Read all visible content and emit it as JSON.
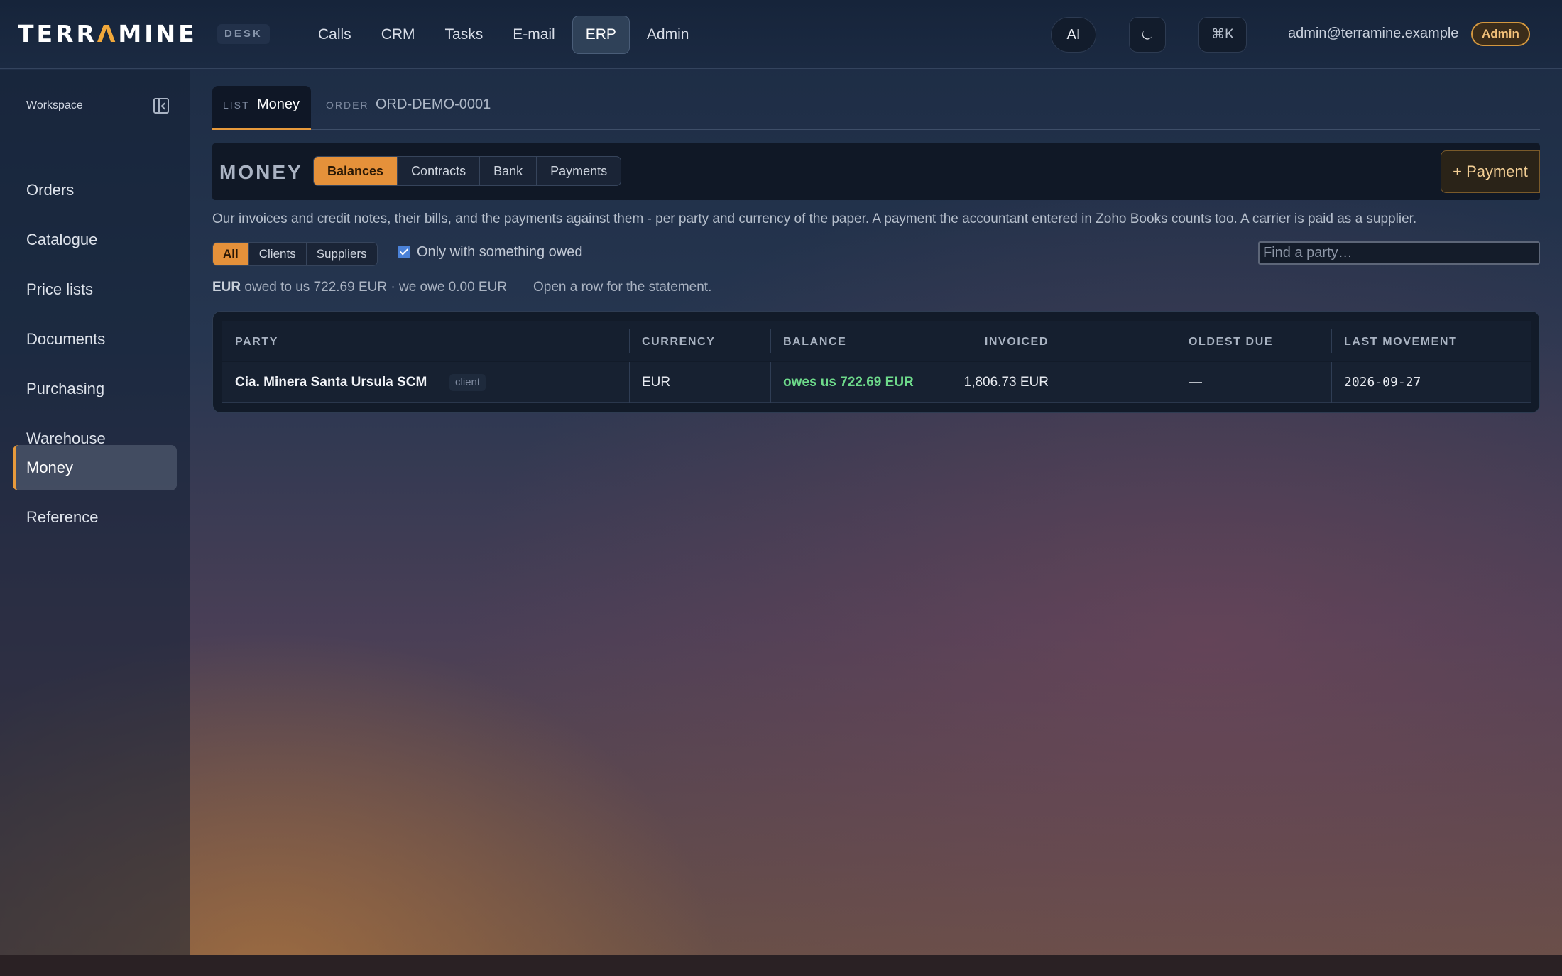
{
  "brand": {
    "logo_pre": "TERR",
    "logo_accent": "Λ",
    "logo_post": "MINE",
    "badge": "DESK",
    "accent_color": "#e5913a"
  },
  "nav": {
    "items": [
      "Calls",
      "CRM",
      "Tasks",
      "E-mail",
      "ERP",
      "Admin"
    ],
    "active": "ERP"
  },
  "header": {
    "ai_label": "AI",
    "theme_icon": "moon-icon",
    "shortcut_label": "⌘K",
    "user_email": "admin@terramine.example",
    "role_badge": "Admin"
  },
  "sidebar": {
    "section_label": "Workspace",
    "collapse_icon": "sidebar-collapse-icon",
    "items": [
      "Orders",
      "Catalogue",
      "Price lists",
      "Documents",
      "Purchasing",
      "Warehouse",
      "Money",
      "Reference"
    ],
    "active": "Money"
  },
  "page_tabs": {
    "list_kicker": "LIST",
    "list_value": "Money",
    "order_kicker": "ORDER",
    "order_value": "ORD-DEMO-0001"
  },
  "money": {
    "title": "MONEY",
    "tabs": [
      "Balances",
      "Contracts",
      "Bank",
      "Payments"
    ],
    "active_tab": "Balances",
    "add_payment_label": "+ Payment",
    "intro": "Our invoices and credit notes, their bills, and the payments against them - per party and currency of the paper. A payment the accountant entered in Zoho Books counts too. A carrier is paid as a supplier.",
    "filters": [
      "All",
      "Clients",
      "Suppliers"
    ],
    "active_filter": "All",
    "only_owed_label": "Only with something owed",
    "only_owed_checked": true,
    "search_placeholder": "Find a party…",
    "summary_currency": "EUR",
    "summary_text": "owed to us 722.69 EUR · we owe 0.00 EUR",
    "summary_hint": "Open a row for the statement."
  },
  "table": {
    "columns": [
      "PARTY",
      "CURRENCY",
      "BALANCE",
      "INVOICED",
      "OLDEST DUE",
      "LAST MOVEMENT"
    ],
    "rows": [
      {
        "party": "Cia. Minera Santa Ursula SCM",
        "party_role": "client",
        "currency": "EUR",
        "balance": "owes us 722.69 EUR",
        "invoiced": "1,806.73 EUR",
        "oldest_due": "—",
        "last_movement": "2026-09-27"
      }
    ]
  }
}
